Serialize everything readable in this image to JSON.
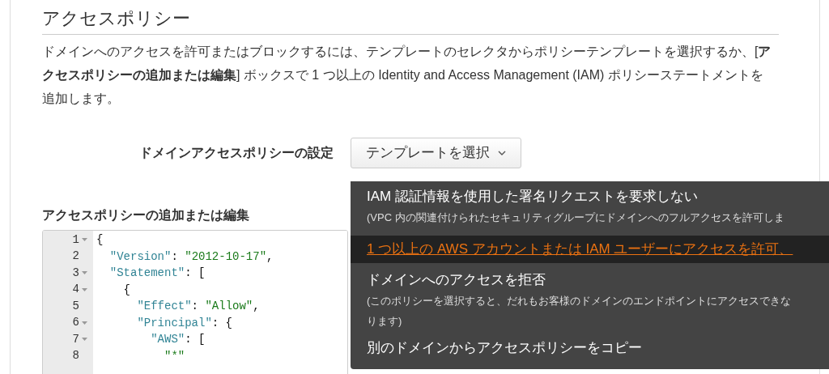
{
  "section": {
    "title": "アクセスポリシー",
    "description": "ドメインへのアクセスを許可またはブロックするには、テンプレートのセレクタからポリシーテンプレートを選択するか、[**アクセスポリシーの追加または編集**] ボックスで 1 つ以上の Identity and Access Management (IAM) ポリシーステートメントを追加します。"
  },
  "policy_setting": {
    "label": "ドメインアクセスポリシーの設定",
    "button": "テンプレートを選択",
    "dropdown_open": true
  },
  "dropdown": [
    {
      "title": "IAM 認証情報を使用した署名リクエストを要求しない",
      "description_lines": [
        "(VPC 内の関連付けられたセキュリティグループにドメインへのフルアクセスを許可しま"
      ],
      "selected": false
    },
    {
      "title": "1 つ以上の AWS アカウントまたは IAM ユーザーにアクセスを許可、",
      "selected": true
    },
    {
      "title": "ドメインへのアクセスを拒否",
      "description_lines": [
        "(このポリシーを選択すると、だれもお客様のドメインのエンドポイントにアクセスできな",
        "ります)"
      ],
      "selected": false
    },
    {
      "title": "別のドメインからアクセスポリシーをコピー",
      "selected": false
    }
  ],
  "editor": {
    "label": "アクセスポリシーの追加または編集",
    "lines": [
      {
        "number": "1",
        "foldable": true,
        "tokens": [
          {
            "kind": "plain",
            "text": "{"
          }
        ],
        "children": [
          {
            "number": "2",
            "foldable": false,
            "tokens": [
              {
                "kind": "key",
                "text": "\"Version\""
              },
              {
                "kind": "plain",
                "text": ": "
              },
              {
                "kind": "string",
                "text": "\"2012-10-17\""
              },
              {
                "kind": "plain",
                "text": ","
              }
            ]
          },
          {
            "number": "3",
            "foldable": true,
            "tokens": [
              {
                "kind": "key",
                "text": "\"Statement\""
              },
              {
                "kind": "plain",
                "text": ": ["
              }
            ],
            "children": [
              {
                "number": "4",
                "foldable": true,
                "tokens": [
                  {
                    "kind": "plain",
                    "text": "{"
                  }
                ],
                "children": [
                  {
                    "number": "5",
                    "foldable": false,
                    "tokens": [
                      {
                        "kind": "key",
                        "text": "\"Effect\""
                      },
                      {
                        "kind": "plain",
                        "text": ": "
                      },
                      {
                        "kind": "string",
                        "text": "\"Allow\""
                      },
                      {
                        "kind": "plain",
                        "text": ","
                      }
                    ]
                  },
                  {
                    "number": "6",
                    "foldable": true,
                    "tokens": [
                      {
                        "kind": "key",
                        "text": "\"Principal\""
                      },
                      {
                        "kind": "plain",
                        "text": ": {"
                      }
                    ],
                    "children": [
                      {
                        "number": "7",
                        "foldable": true,
                        "tokens": [
                          {
                            "kind": "key",
                            "text": "\"AWS\""
                          },
                          {
                            "kind": "plain",
                            "text": ": ["
                          }
                        ],
                        "children": [
                          {
                            "number": "8",
                            "foldable": false,
                            "tokens": [
                              {
                                "kind": "string",
                                "text": "\"*\""
                              }
                            ]
                          }
                        ]
                      }
                    ]
                  }
                ]
              }
            ]
          }
        ]
      }
    ]
  }
}
